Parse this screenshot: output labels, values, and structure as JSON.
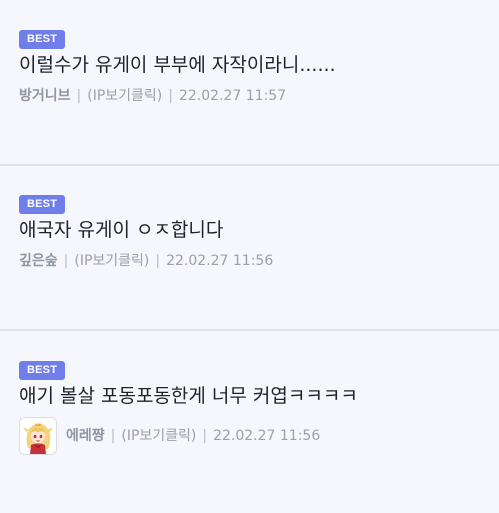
{
  "posts": [
    {
      "badge": "BEST",
      "title": "이럴수가 유게이 부부에 자작이라니......",
      "author": "방거니브",
      "ip_label": "(IP보기클릭)",
      "separator": "|",
      "datetime": "22.02.27 11:57"
    },
    {
      "badge": "BEST",
      "title": "애국자 유게이 ㅇㅈ합니다",
      "author": "깊은숲",
      "ip_label": "(IP보기클릭)",
      "separator": "|",
      "datetime": "22.02.27 11:56"
    },
    {
      "badge": "BEST",
      "title": "애기 볼살 포동포동한게 너무 커엽ㅋㅋㅋㅋ",
      "author": "에레쨩",
      "ip_label": "(IP보기클릭)",
      "separator": "|",
      "datetime": "22.02.27 11:56",
      "avatar_icon": "anime-girl-avatar"
    }
  ],
  "colors": {
    "badge_bg": "#6f7ee8",
    "page_bg": "#f5f7fc",
    "divider": "#dfe2e9"
  }
}
